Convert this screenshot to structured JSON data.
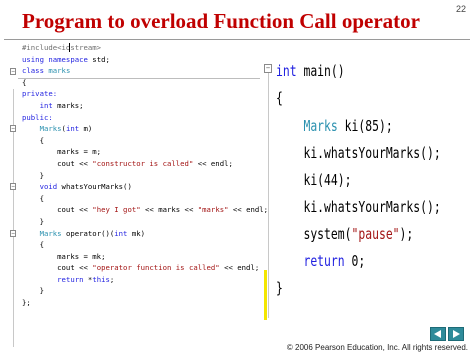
{
  "slide": {
    "number": "22"
  },
  "title": "Program to overload Function Call operator",
  "left_code": [
    [
      "#include<io",
      "stream>"
    ],
    "using namespace std;",
    "class marks",
    "{",
    "private:",
    "    int marks;",
    "public:",
    "    Marks(int m)",
    "    {",
    "        marks = m;",
    "        cout << \"constructor is called\" << endl;",
    "    }",
    "    void whatsYourMarks()",
    "    {",
    "        cout << \"hey I got\" << marks << \"marks\" << endl;",
    "    }",
    "    Marks operator()(int mk)",
    "    {",
    "        marks = mk;",
    "        cout << \"operator function is called\" << endl;",
    "        return *this;",
    "    }",
    "};"
  ],
  "right_code": [
    "int main()",
    "{",
    "    Marks ki(85);",
    "    ki.whatsYourMarks();",
    "    ki(44);",
    "    ki.whatsYourMarks();",
    "    system(\"pause\");",
    "    return 0;",
    "}"
  ],
  "icons": {
    "collapse": "minus-box-icon",
    "prev": "triangle-left-icon",
    "next": "triangle-right-icon"
  },
  "colors": {
    "title": "#c00000",
    "keyword": "#1f1fe0",
    "type": "#2b91af",
    "string": "#a31515",
    "nav": "#2e8b9a",
    "change_bar": "#f3e600"
  },
  "footer": "© 2006 Pearson Education, Inc.  All rights reserved."
}
